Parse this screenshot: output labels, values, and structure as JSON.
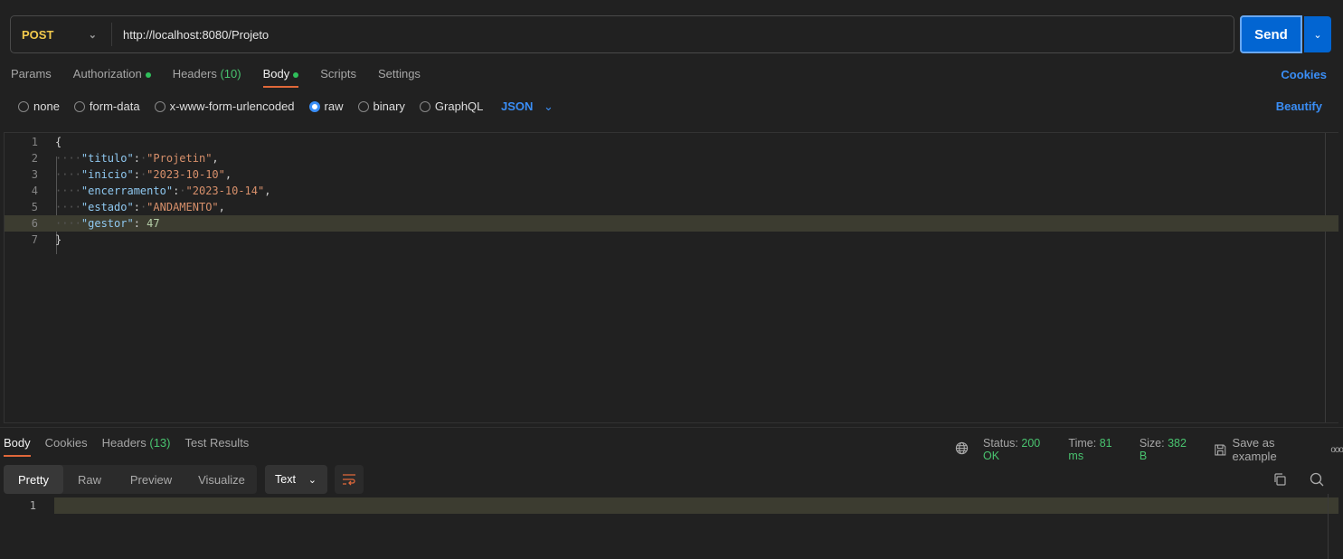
{
  "request": {
    "method": "POST",
    "url": "http://localhost:8080/Projeto",
    "send_label": "Send"
  },
  "tabs": [
    {
      "label": "Params"
    },
    {
      "label": "Authorization",
      "dot": true
    },
    {
      "label": "Headers",
      "count": "(10)"
    },
    {
      "label": "Body",
      "dot": true,
      "active": true
    },
    {
      "label": "Scripts"
    },
    {
      "label": "Settings"
    }
  ],
  "cookies_label": "Cookies",
  "body_types": [
    {
      "label": "none"
    },
    {
      "label": "form-data"
    },
    {
      "label": "x-www-form-urlencoded"
    },
    {
      "label": "raw",
      "selected": true
    },
    {
      "label": "binary"
    },
    {
      "label": "GraphQL"
    }
  ],
  "format": "JSON",
  "beautify_label": "Beautify",
  "editor": {
    "lines": [
      [
        [
          "p",
          "{"
        ]
      ],
      [
        [
          "ws",
          "····"
        ],
        [
          "k",
          "\"titulo\""
        ],
        [
          "p",
          ":"
        ],
        [
          "ws",
          "·"
        ],
        [
          "s",
          "\"Projetin\""
        ],
        [
          "p",
          ","
        ]
      ],
      [
        [
          "ws",
          "····"
        ],
        [
          "k",
          "\"inicio\""
        ],
        [
          "p",
          ":"
        ],
        [
          "ws",
          "·"
        ],
        [
          "s",
          "\"2023-10-10\""
        ],
        [
          "p",
          ","
        ]
      ],
      [
        [
          "ws",
          "····"
        ],
        [
          "k",
          "\"encerramento\""
        ],
        [
          "p",
          ":"
        ],
        [
          "ws",
          "·"
        ],
        [
          "s",
          "\"2023-10-14\""
        ],
        [
          "p",
          ","
        ]
      ],
      [
        [
          "ws",
          "····"
        ],
        [
          "k",
          "\"estado\""
        ],
        [
          "p",
          ":"
        ],
        [
          "ws",
          "·"
        ],
        [
          "s",
          "\"ANDAMENTO\""
        ],
        [
          "p",
          ","
        ]
      ],
      [
        [
          "ws",
          "····"
        ],
        [
          "k",
          "\"gestor\""
        ],
        [
          "p",
          ": "
        ],
        [
          "n",
          "47"
        ]
      ],
      [
        [
          "p",
          "}"
        ]
      ]
    ],
    "highlight_line": 6
  },
  "response": {
    "tabs": [
      {
        "label": "Body",
        "active": true
      },
      {
        "label": "Cookies"
      },
      {
        "label": "Headers",
        "count": "(13)"
      },
      {
        "label": "Test Results"
      }
    ],
    "status_label": "Status:",
    "status": "200 OK",
    "time_label": "Time:",
    "time": "81 ms",
    "size_label": "Size:",
    "size": "382 B",
    "save_label": "Save as example",
    "views": [
      "Pretty",
      "Raw",
      "Preview",
      "Visualize"
    ],
    "active_view": "Pretty",
    "text_format": "Text",
    "line_numbers": [
      "1"
    ]
  },
  "colors": {
    "accent": "#0265d2",
    "link": "#3a8ef6",
    "method": "#f2c94c",
    "success": "#49c36f",
    "active_tab": "#e0683a"
  }
}
